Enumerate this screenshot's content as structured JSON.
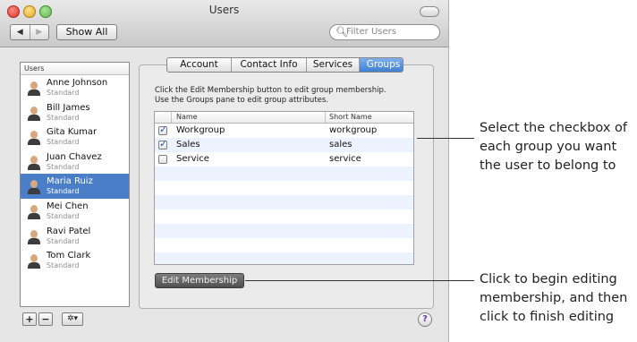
{
  "window": {
    "title": "Users",
    "show_all": "Show All",
    "nav_back": "◀",
    "nav_forward": "▶",
    "search_placeholder": "Filter Users"
  },
  "users": {
    "header": "Users",
    "items": [
      {
        "name": "Anne Johnson",
        "role": "Standard",
        "selected": false
      },
      {
        "name": "Bill James",
        "role": "Standard",
        "selected": false
      },
      {
        "name": "Gita Kumar",
        "role": "Standard",
        "selected": false
      },
      {
        "name": "Juan Chavez",
        "role": "Standard",
        "selected": false
      },
      {
        "name": "Maria Ruiz",
        "role": "Standard",
        "selected": true
      },
      {
        "name": "Mei Chen",
        "role": "Standard",
        "selected": false
      },
      {
        "name": "Ravi Patel",
        "role": "Standard",
        "selected": false
      },
      {
        "name": "Tom Clark",
        "role": "Standard",
        "selected": false
      }
    ]
  },
  "tabs": [
    {
      "label": "Account",
      "active": false
    },
    {
      "label": "Contact Info",
      "active": false
    },
    {
      "label": "Services",
      "active": false
    },
    {
      "label": "Groups",
      "active": true
    }
  ],
  "instructions": {
    "line1": "Click the Edit Membership button to edit group membership.",
    "line2": "Use the Groups pane to edit group attributes."
  },
  "groups": {
    "col_name": "Name",
    "col_short": "Short Name",
    "rows": [
      {
        "name": "Workgroup",
        "short": "workgroup",
        "checked": true
      },
      {
        "name": "Sales",
        "short": "sales",
        "checked": true
      },
      {
        "name": "Service",
        "short": "service",
        "checked": false
      }
    ]
  },
  "edit_membership": "Edit Membership",
  "bottom": {
    "add": "+",
    "remove": "−",
    "action": "✲▾",
    "help": "?"
  },
  "callouts": {
    "top": [
      "Select the checkbox of",
      "each group you want",
      "the user to belong to"
    ],
    "bottom": [
      "Click to begin editing",
      "membership, and then",
      "click to finish editing"
    ]
  },
  "colors": {
    "selection": "#4a7ec9",
    "tab_active": "#3f7fd1",
    "checkmark": "#1d55b4"
  }
}
